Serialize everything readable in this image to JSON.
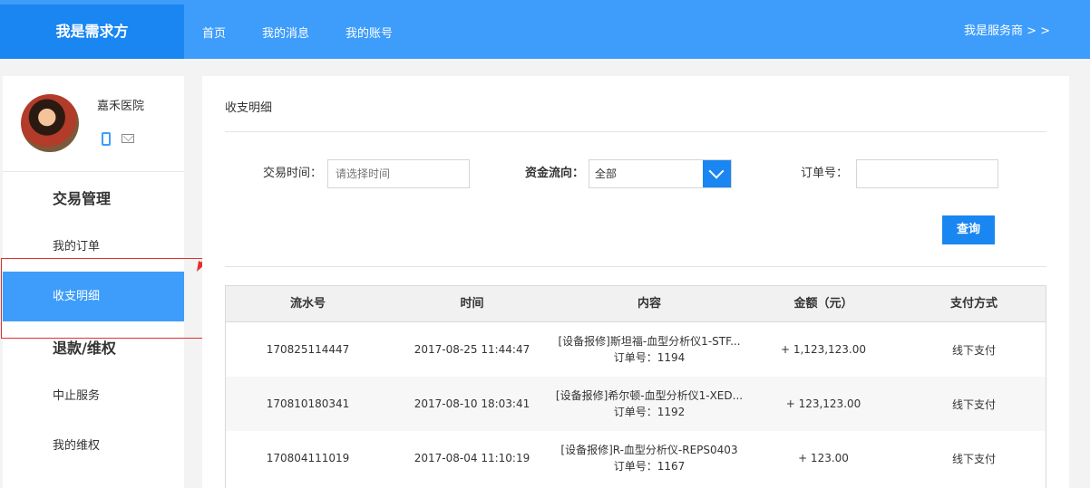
{
  "header": {
    "brand": "我是需求方",
    "nav": [
      "首页",
      "我的消息",
      "我的账号"
    ],
    "switch_role": "我是服务商 > >"
  },
  "sidebar": {
    "user_name": "嘉禾医院",
    "sections": [
      {
        "title": "交易管理",
        "items": [
          "我的订单",
          "收支明细"
        ]
      },
      {
        "title": "退款/维权",
        "items": [
          "中止服务",
          "我的维权"
        ]
      }
    ],
    "active_item": "收支明细"
  },
  "main": {
    "title": "收支明细",
    "filters": {
      "time_label": "交易时间：",
      "time_placeholder": "请选择时间",
      "flow_label": "资金流向：",
      "flow_value": "全部",
      "order_label": "订单号：",
      "order_value": ""
    },
    "query_button": "查询",
    "table": {
      "headers": [
        "流水号",
        "时间",
        "内容",
        "金额（元）",
        "支付方式"
      ],
      "rows": [
        {
          "serial": "170825114447",
          "time": "2017-08-25 11:44:47",
          "content": "[设备报修]斯坦福-血型分析仪1-STF...",
          "order": "订单号：1194",
          "amount": "+ 1,123,123.00",
          "payment": "线下支付"
        },
        {
          "serial": "170810180341",
          "time": "2017-08-10 18:03:41",
          "content": "[设备报修]希尔顿-血型分析仪1-XED...",
          "order": "订单号：1192",
          "amount": "+ 123,123.00",
          "payment": "线下支付"
        },
        {
          "serial": "170804111019",
          "time": "2017-08-04 11:10:19",
          "content": "[设备报修]R-血型分析仪-REPS0403",
          "order": "订单号：1167",
          "amount": "+ 123.00",
          "payment": "线下支付"
        }
      ]
    }
  },
  "colors": {
    "header": "#3e9dfb",
    "brand": "#1a86f1",
    "annotation": "#e03030"
  }
}
